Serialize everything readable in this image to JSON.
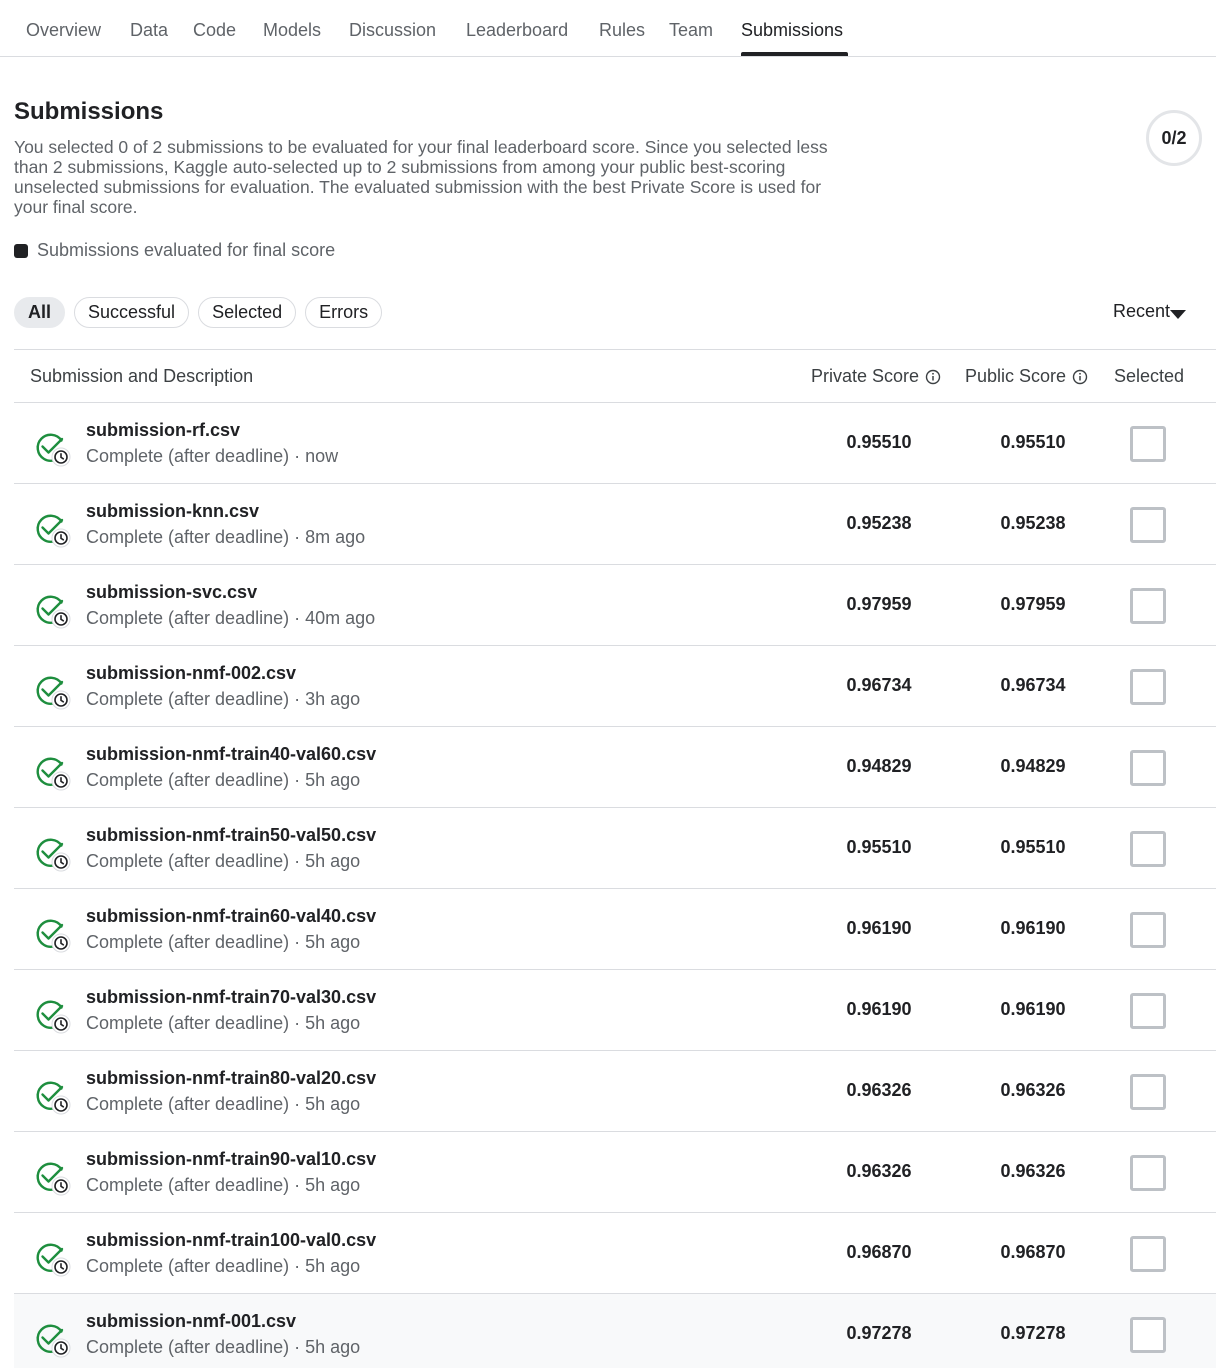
{
  "tabs": [
    {
      "label": "Overview"
    },
    {
      "label": "Data"
    },
    {
      "label": "Code"
    },
    {
      "label": "Models"
    },
    {
      "label": "Discussion"
    },
    {
      "label": "Leaderboard"
    },
    {
      "label": "Rules"
    },
    {
      "label": "Team"
    },
    {
      "label": "Submissions",
      "active": true
    }
  ],
  "header": {
    "title": "Submissions",
    "description": "You selected 0 of 2 submissions to be evaluated for your final leaderboard score. Since you selected less than 2 submissions, Kaggle auto-selected up to 2 submissions from among your public best-scoring unselected submissions for evaluation. The evaluated submission with the best Private Score is used for your final score.",
    "selection_counter": "0/2",
    "legend_label": "Submissions evaluated for final score"
  },
  "filters": {
    "chips": [
      "All",
      "Successful",
      "Selected",
      "Errors"
    ],
    "active": "All",
    "sort_label": "Recent"
  },
  "table": {
    "headers": {
      "submission": "Submission and Description",
      "private": "Private Score",
      "public": "Public Score",
      "selected": "Selected"
    },
    "rows": [
      {
        "file": "submission-rf.csv",
        "status": "Complete (after deadline) · now",
        "private": "0.95510",
        "public": "0.95510",
        "selected": false
      },
      {
        "file": "submission-knn.csv",
        "status": "Complete (after deadline) · 8m ago",
        "private": "0.95238",
        "public": "0.95238",
        "selected": false
      },
      {
        "file": "submission-svc.csv",
        "status": "Complete (after deadline) · 40m ago",
        "private": "0.97959",
        "public": "0.97959",
        "selected": false
      },
      {
        "file": "submission-nmf-002.csv",
        "status": "Complete (after deadline) · 3h ago",
        "private": "0.96734",
        "public": "0.96734",
        "selected": false
      },
      {
        "file": "submission-nmf-train40-val60.csv",
        "status": "Complete (after deadline) · 5h ago",
        "private": "0.94829",
        "public": "0.94829",
        "selected": false
      },
      {
        "file": "submission-nmf-train50-val50.csv",
        "status": "Complete (after deadline) · 5h ago",
        "private": "0.95510",
        "public": "0.95510",
        "selected": false
      },
      {
        "file": "submission-nmf-train60-val40.csv",
        "status": "Complete (after deadline) · 5h ago",
        "private": "0.96190",
        "public": "0.96190",
        "selected": false
      },
      {
        "file": "submission-nmf-train70-val30.csv",
        "status": "Complete (after deadline) · 5h ago",
        "private": "0.96190",
        "public": "0.96190",
        "selected": false
      },
      {
        "file": "submission-nmf-train80-val20.csv",
        "status": "Complete (after deadline) · 5h ago",
        "private": "0.96326",
        "public": "0.96326",
        "selected": false
      },
      {
        "file": "submission-nmf-train90-val10.csv",
        "status": "Complete (after deadline) · 5h ago",
        "private": "0.96326",
        "public": "0.96326",
        "selected": false
      },
      {
        "file": "submission-nmf-train100-val0.csv",
        "status": "Complete (after deadline) · 5h ago",
        "private": "0.96870",
        "public": "0.96870",
        "selected": false
      },
      {
        "file": "submission-nmf-001.csv",
        "status": "Complete (after deadline) · 5h ago",
        "private": "0.97278",
        "public": "0.97278",
        "selected": false
      }
    ]
  },
  "icons": {
    "status": "complete-after-deadline-icon",
    "info": "info-icon",
    "sort": "caret-down-icon"
  },
  "colors": {
    "success_green": "#1e8e3e",
    "text_primary": "#202124",
    "text_secondary": "#5f6368",
    "border": "#dadce0"
  }
}
